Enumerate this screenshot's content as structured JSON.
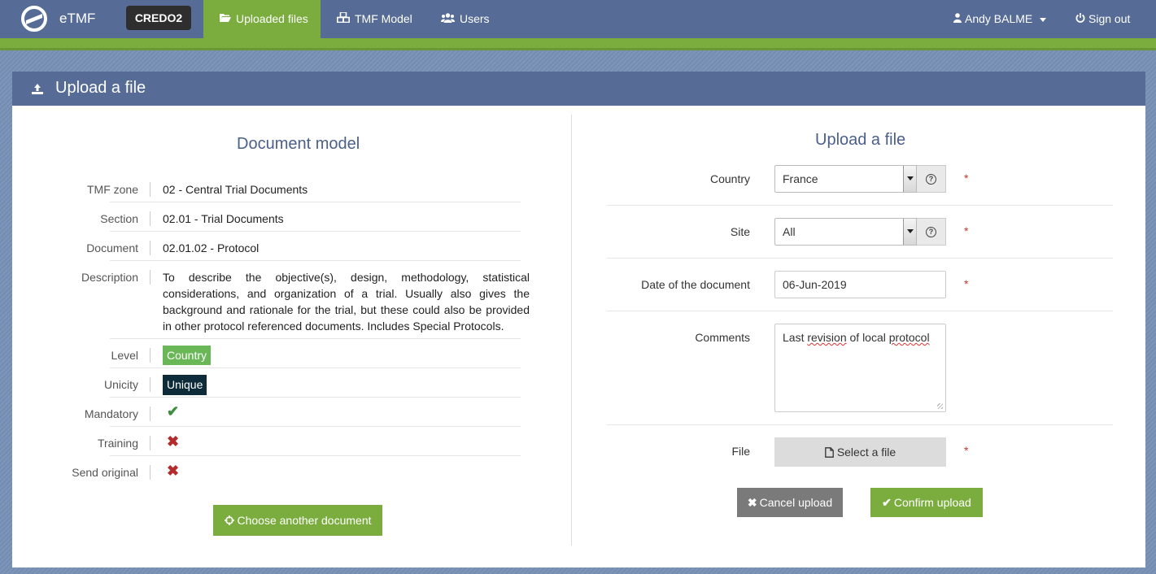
{
  "navbar": {
    "brand": "eTMF",
    "study": "CREDO2",
    "items": [
      {
        "label": "Uploaded files",
        "icon": "folder-open-icon"
      },
      {
        "label": "TMF Model",
        "icon": "cubes-icon"
      },
      {
        "label": "Users",
        "icon": "users-icon"
      }
    ],
    "user": "Andy BALME",
    "signout": "Sign out",
    "colors": {
      "bar": "#566c96",
      "accent": "#7aad3e"
    }
  },
  "panel": {
    "title": "Upload a file"
  },
  "document_model": {
    "title": "Document model",
    "rows": [
      {
        "label": "TMF zone",
        "value": "02 - Central Trial Documents"
      },
      {
        "label": "Section",
        "value": "02.01 - Trial Documents"
      },
      {
        "label": "Document",
        "value": "02.01.02 - Protocol"
      },
      {
        "label": "Description",
        "value": "To describe the objective(s), design, methodology, statistical considerations, and organization of a trial. Usually also gives the background and rationale for the trial, but these could also be provided in other protocol referenced documents. Includes Special Protocols."
      },
      {
        "label": "Level",
        "value": "Country"
      },
      {
        "label": "Unicity",
        "value": "Unique"
      },
      {
        "label": "Mandatory",
        "value": "✔"
      },
      {
        "label": "Training",
        "value": "✖"
      },
      {
        "label": "Send original",
        "value": "✖"
      }
    ],
    "choose_button": "Choose another document"
  },
  "upload_form": {
    "title": "Upload a file",
    "country": {
      "label": "Country",
      "value": "France"
    },
    "site": {
      "label": "Site",
      "value": "All"
    },
    "date": {
      "label": "Date of the document",
      "value": "06-Jun-2019"
    },
    "comments": {
      "label": "Comments",
      "value_prefix": "Last ",
      "value_spell": "revision",
      "value_mid": " of local ",
      "value_spell2": "protocol"
    },
    "file": {
      "label": "File",
      "button": "Select a file"
    },
    "required_mark": "*",
    "help_icon": "?",
    "cancel_button": "Cancel upload",
    "confirm_button": "Confirm upload"
  }
}
